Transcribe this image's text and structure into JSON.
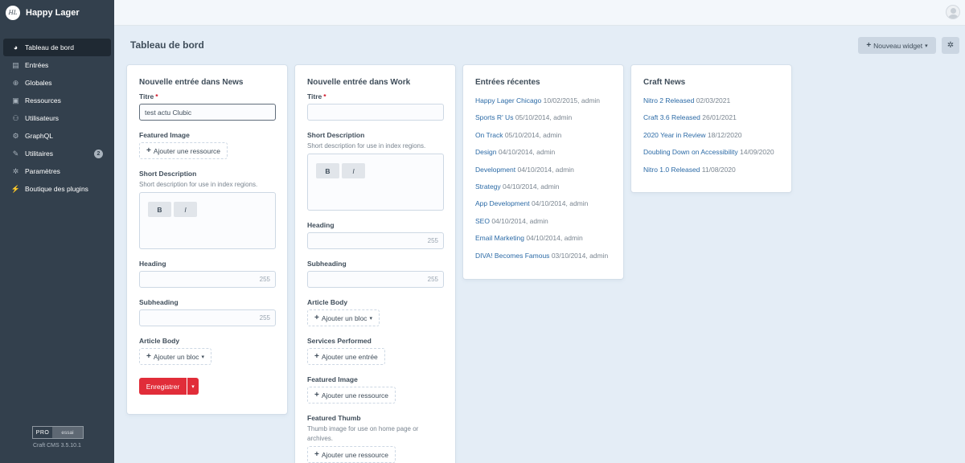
{
  "app": {
    "name": "Happy Lager",
    "logo_text": "HL"
  },
  "sidebar": {
    "items": [
      {
        "label": "Tableau de bord",
        "icon": "gauge-icon",
        "glyph": "◕",
        "active": true
      },
      {
        "label": "Entrées",
        "icon": "newspaper-icon",
        "glyph": "▤"
      },
      {
        "label": "Globales",
        "icon": "globe-icon",
        "glyph": "⊕"
      },
      {
        "label": "Ressources",
        "icon": "image-icon",
        "glyph": "▣"
      },
      {
        "label": "Utilisateurs",
        "icon": "users-icon",
        "glyph": "⚇"
      },
      {
        "label": "GraphQL",
        "icon": "graphql-icon",
        "glyph": "⚙"
      },
      {
        "label": "Utilitaires",
        "icon": "wrench-icon",
        "glyph": "✎",
        "badge": "2"
      },
      {
        "label": "Paramètres",
        "icon": "gear-icon",
        "glyph": "✲"
      },
      {
        "label": "Boutique des plugins",
        "icon": "plug-icon",
        "glyph": "⚡"
      }
    ],
    "edition_pro": "PRO",
    "edition_trial": "essai",
    "version": "Craft CMS 3.5.10.1"
  },
  "header": {
    "page_title": "Tableau de bord",
    "new_widget_label": "Nouveau widget",
    "settings_glyph": "✲"
  },
  "news_widget": {
    "title": "Nouvelle entrée dans News",
    "titre_label": "Titre",
    "titre_value": "test actu Clubic",
    "featured_image_label": "Featured Image",
    "add_resource_label": "Ajouter une ressource",
    "short_desc_label": "Short Description",
    "short_desc_instructions": "Short description for use in index regions.",
    "bold_label": "B",
    "italic_label": "I",
    "heading_label": "Heading",
    "heading_count": "255",
    "subheading_label": "Subheading",
    "subheading_count": "255",
    "article_body_label": "Article Body",
    "add_block_label": "Ajouter un bloc",
    "save_label": "Enregistrer"
  },
  "work_widget": {
    "title": "Nouvelle entrée dans Work",
    "titre_label": "Titre",
    "short_desc_label": "Short Description",
    "short_desc_instructions": "Short description for use in index regions.",
    "bold_label": "B",
    "italic_label": "I",
    "heading_label": "Heading",
    "heading_count": "255",
    "subheading_label": "Subheading",
    "subheading_count": "255",
    "article_body_label": "Article Body",
    "add_block_label": "Ajouter un bloc",
    "services_label": "Services Performed",
    "add_entry_label": "Ajouter une entrée",
    "featured_image_label": "Featured Image",
    "add_resource_label": "Ajouter une ressource",
    "featured_thumb_label": "Featured Thumb",
    "featured_thumb_instructions": "Thumb image for use on home page or archives.",
    "add_resource_label_2": "Ajouter une ressource"
  },
  "recent_widget": {
    "title": "Entrées récentes",
    "entries": [
      {
        "title": "Happy Lager Chicago",
        "meta": "10/02/2015, admin"
      },
      {
        "title": "Sports R' Us",
        "meta": "05/10/2014, admin"
      },
      {
        "title": "On Track",
        "meta": "05/10/2014, admin"
      },
      {
        "title": "Design",
        "meta": "04/10/2014, admin"
      },
      {
        "title": "Development",
        "meta": "04/10/2014, admin"
      },
      {
        "title": "Strategy",
        "meta": "04/10/2014, admin"
      },
      {
        "title": "App Development",
        "meta": "04/10/2014, admin"
      },
      {
        "title": "SEO",
        "meta": "04/10/2014, admin"
      },
      {
        "title": "Email Marketing",
        "meta": "04/10/2014, admin"
      },
      {
        "title": "DIVA! Becomes Famous",
        "meta": "03/10/2014, admin"
      }
    ]
  },
  "craft_news_widget": {
    "title": "Craft News",
    "items": [
      {
        "title": "Nitro 2 Released",
        "date": "02/03/2021"
      },
      {
        "title": "Craft 3.6 Released",
        "date": "26/01/2021"
      },
      {
        "title": "2020 Year in Review",
        "date": "18/12/2020"
      },
      {
        "title": "Doubling Down on Accessibility",
        "date": "14/09/2020"
      },
      {
        "title": "Nitro 1.0 Released",
        "date": "11/08/2020"
      }
    ]
  },
  "colors": {
    "sidebar": "#33404d",
    "accent_red": "#e12d39",
    "link": "#2b6aa6",
    "page_bg": "#e4edf6"
  }
}
